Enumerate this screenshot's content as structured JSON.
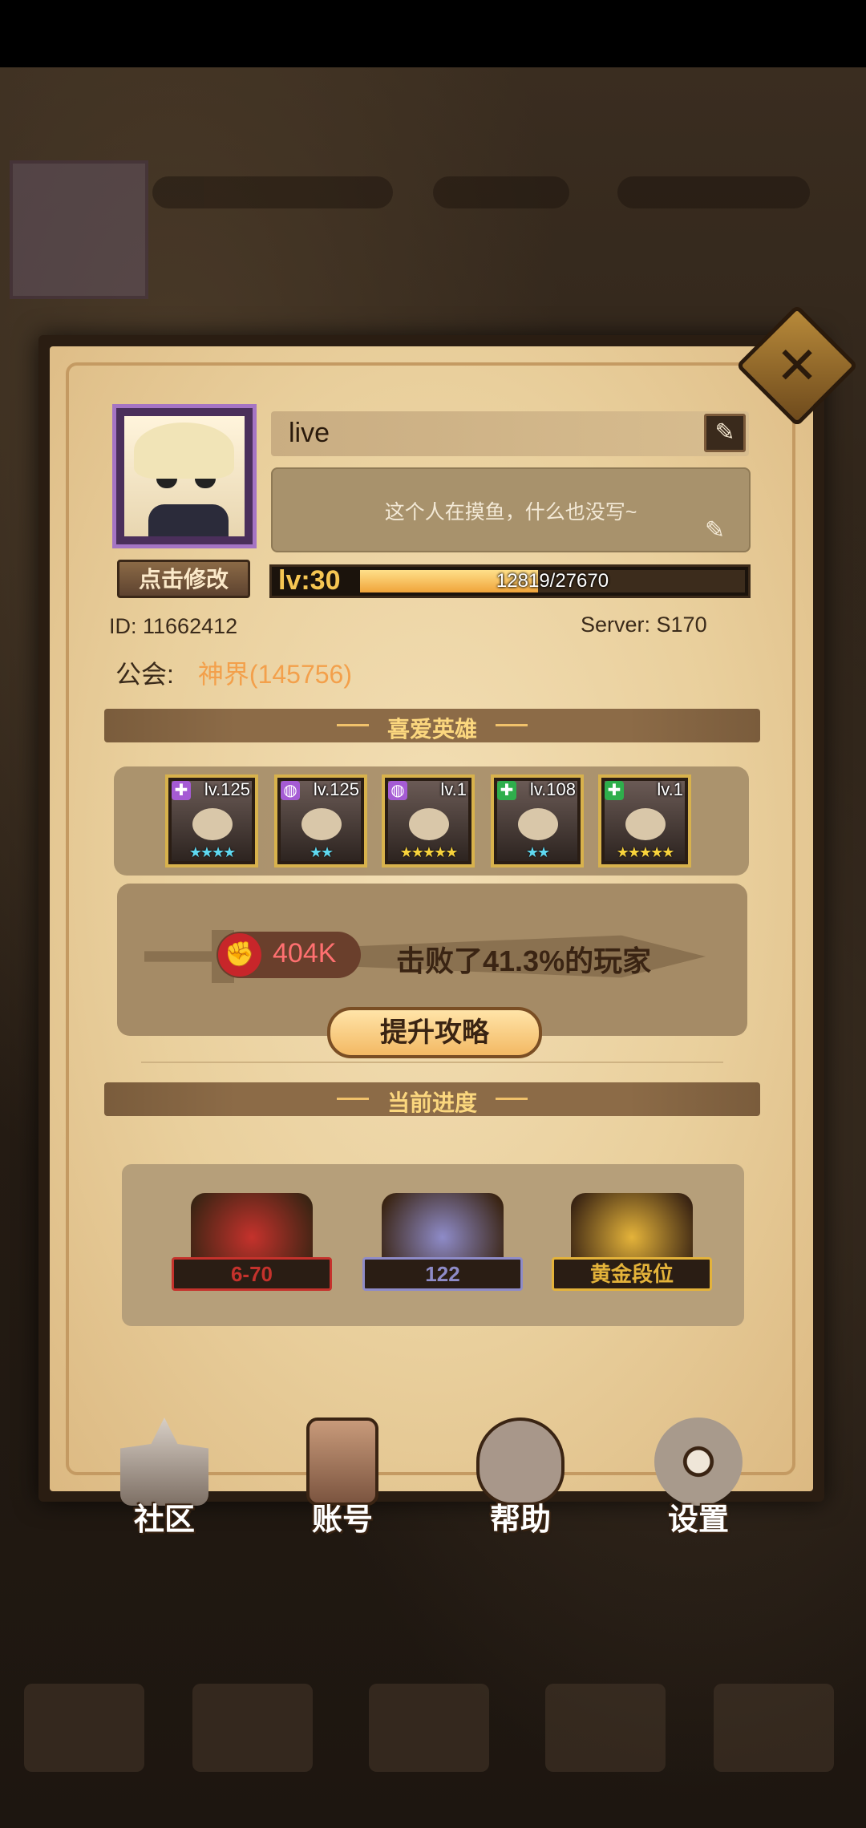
{
  "profile": {
    "name": "live",
    "signature": "这个人在摸鱼，什么也没写~",
    "edit_avatar_label": "点击修改",
    "level_label": "lv:30",
    "exp_current": 12819,
    "exp_max": 27670,
    "exp_text": "12819/27670",
    "id_text": "ID:  11662412",
    "server_text": "Server: S170",
    "guild_label": "公会:",
    "guild_name": "神界(145756)"
  },
  "favorites": {
    "title": "喜爱英雄",
    "heroes": [
      {
        "level": "lv.125",
        "stars": "★★★★",
        "star_color": "#5fd8f0",
        "class_color": "#a55bd4",
        "class_icon": "✚"
      },
      {
        "level": "lv.125",
        "stars": "★★",
        "star_color": "#5fd8f0",
        "class_color": "#a55bd4",
        "class_icon": "◍"
      },
      {
        "level": "lv.1",
        "stars": "★★★★★",
        "star_color": "#f7d23c",
        "class_color": "#a55bd4",
        "class_icon": "◍"
      },
      {
        "level": "lv.108",
        "stars": "★★",
        "star_color": "#5fd8f0",
        "class_color": "#2fae4c",
        "class_icon": "✚"
      },
      {
        "level": "lv.1",
        "stars": "★★★★★",
        "star_color": "#f7d23c",
        "class_color": "#2fae4c",
        "class_icon": "✚"
      }
    ],
    "power": "404K",
    "defeat_text": "击败了41.3%的玩家",
    "strategy_label": "提升攻略"
  },
  "progress": {
    "title": "当前进度",
    "items": [
      {
        "label": "6-70",
        "color": "#c5322c"
      },
      {
        "label": "122",
        "color": "#8e8bc8"
      },
      {
        "label": "黄金段位",
        "color": "#e4b33a"
      }
    ]
  },
  "nav": [
    {
      "label": "社区",
      "icon": "castle-icon"
    },
    {
      "label": "账号",
      "icon": "account-card-icon"
    },
    {
      "label": "帮助",
      "icon": "chat-bubble-icon"
    },
    {
      "label": "设置",
      "icon": "gear-icon"
    }
  ],
  "colors": {
    "accent_gold": "#f6c653",
    "parchment": "#e9cf9c",
    "guild_orange": "#f3a04b"
  }
}
